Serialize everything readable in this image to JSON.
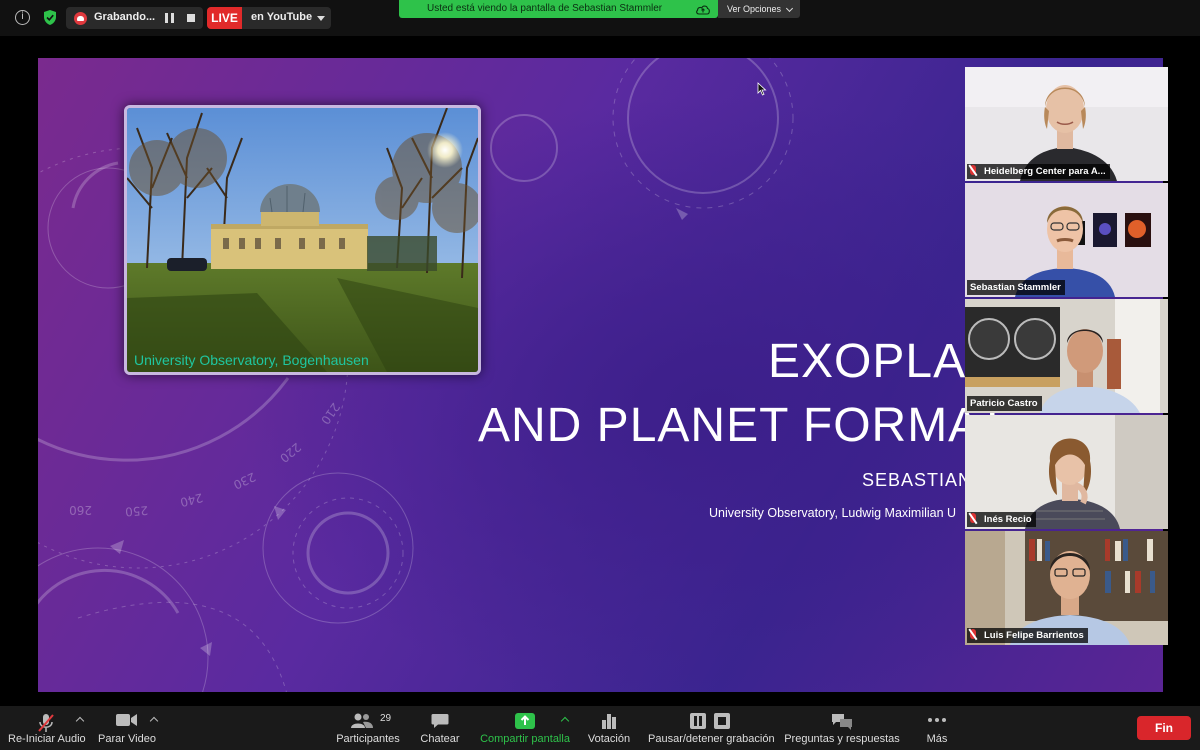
{
  "topbar": {
    "recording_label": "Grabando...",
    "live_badge": "LIVE",
    "live_destination": "en YouTube",
    "share_banner": "Usted está viendo la pantalla de Sebastian Stammler",
    "view_options": "Ver Opciones"
  },
  "slide": {
    "photo_caption": "University Observatory, Bogenhausen",
    "title_line1": "EXOPLAN",
    "title_line2": "AND PLANET FORMAT",
    "author": "SEBASTIAN S",
    "affiliation": "University Observatory, Ludwig Maximilian U",
    "dial_numbers": [
      "260",
      "250",
      "240",
      "230",
      "220",
      "210"
    ]
  },
  "participants": [
    {
      "name": "Heidelberg Center para A...",
      "muted": true,
      "active": false
    },
    {
      "name": "Sebastian Stammler",
      "muted": false,
      "active": true
    },
    {
      "name": "Patricio Castro",
      "muted": false,
      "active": false
    },
    {
      "name": "Inés Recio",
      "muted": true,
      "active": false
    },
    {
      "name": "Luis Felipe Barrientos",
      "muted": true,
      "active": false
    }
  ],
  "toolbar": {
    "audio": "Re-Iniciar Audio",
    "video": "Parar Video",
    "participants": "Participantes",
    "participants_count": "29",
    "chat": "Chatear",
    "share": "Compartir pantalla",
    "poll": "Votación",
    "recording": "Pausar/detener grabación",
    "qa": "Preguntas y respuestas",
    "more": "Más",
    "end": "Fin"
  },
  "colors": {
    "share_green": "#2ec24a",
    "live_red": "#e12a2a",
    "end_red": "#d9262b",
    "active_speaker": "#e7e062",
    "caption_teal": "#1fc6a0"
  }
}
